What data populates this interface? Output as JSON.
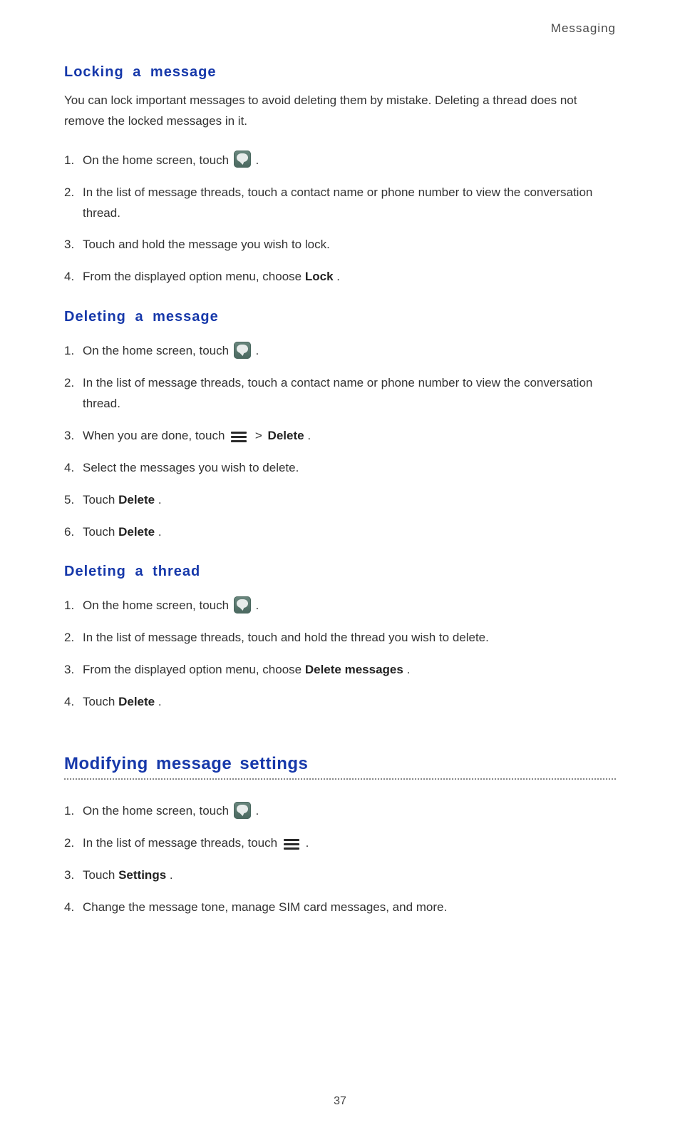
{
  "header": "Messaging",
  "page_number": "37",
  "sections": [
    {
      "title": "Locking  a  message",
      "intro": "You can lock important messages to avoid deleting them by mistake. Deleting a thread does not remove the locked messages in it.",
      "steps": [
        {
          "pre": "On the home screen, touch ",
          "icon": "msg",
          "post": " ."
        },
        {
          "text": "In the list of message threads, touch a contact name or phone number to view the conversation thread."
        },
        {
          "text": "Touch and hold the message you wish to lock."
        },
        {
          "pre": "From the displayed option menu, choose ",
          "bold": "Lock",
          "post": "."
        }
      ]
    },
    {
      "title": "Deleting  a  message",
      "steps": [
        {
          "pre": "On the home screen, touch ",
          "icon": "msg",
          "post": " ."
        },
        {
          "text": "In the list of message threads, touch a contact name or phone number to view the conversation thread."
        },
        {
          "pre": "When you are done, touch ",
          "icon": "menu",
          "gt": true,
          "bold": "Delete",
          "post": "."
        },
        {
          "text": "Select the messages you wish to delete."
        },
        {
          "pre": "Touch ",
          "bold": "Delete",
          "post": "."
        },
        {
          "pre": "Touch ",
          "bold": "Delete",
          "post": "."
        }
      ]
    },
    {
      "title": "Deleting  a  thread",
      "steps": [
        {
          "pre": "On the home screen, touch ",
          "icon": "msg",
          "post": " ."
        },
        {
          "text": "In the list of message threads, touch and hold the thread you wish to delete."
        },
        {
          "pre": "From the displayed option menu, choose ",
          "bold": "Delete messages",
          "post": "."
        },
        {
          "pre": "Touch ",
          "bold": "Delete",
          "post": "."
        }
      ]
    }
  ],
  "major": {
    "title": "Modifying message settings",
    "steps": [
      {
        "pre": "On the home screen, touch ",
        "icon": "msg",
        "post": " ."
      },
      {
        "pre": "In the list of message threads, touch ",
        "icon": "menu",
        "post": " ."
      },
      {
        "pre": "Touch ",
        "bold": "Settings",
        "post": "."
      },
      {
        "text": "Change the message tone, manage SIM card messages, and more."
      }
    ]
  }
}
